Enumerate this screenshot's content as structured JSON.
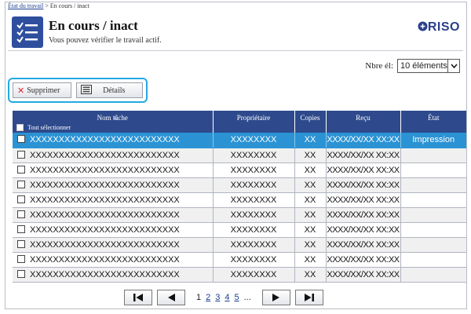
{
  "breadcrumb": {
    "parent": "État du travail",
    "separator": " > ",
    "current": "En cours / inact"
  },
  "header": {
    "title": "En cours / inact",
    "subtitle": "Vous pouvez vérifier le travail actif.",
    "logo_text": "RISO"
  },
  "per_page": {
    "label": "Nbre él:",
    "value": "10 éléments"
  },
  "toolbar": {
    "delete_label": "Supprimer",
    "details_label": "Détails"
  },
  "table": {
    "columns": {
      "name": "Nom tâche",
      "owner": "Propriétaire",
      "copies": "Copies",
      "received": "Reçu",
      "state": "État"
    },
    "select_all_label": "Tout sélectionner",
    "rows": [
      {
        "name": "XXXXXXXXXXXXXXXXXXXXXXXXXX",
        "owner": "XXXXXXXX",
        "copies": "XX",
        "received": "XXXX/XX/XX XX:XX",
        "state": "Impression",
        "active": true
      },
      {
        "name": "XXXXXXXXXXXXXXXXXXXXXXXXXX",
        "owner": "XXXXXXXX",
        "copies": "XX",
        "received": "XXXX/XX/XX XX:XX",
        "state": ""
      },
      {
        "name": "XXXXXXXXXXXXXXXXXXXXXXXXXX",
        "owner": "XXXXXXXX",
        "copies": "XX",
        "received": "XXXX/XX/XX XX:XX",
        "state": ""
      },
      {
        "name": "XXXXXXXXXXXXXXXXXXXXXXXXXX",
        "owner": "XXXXXXXX",
        "copies": "XX",
        "received": "XXXX/XX/XX XX:XX",
        "state": ""
      },
      {
        "name": "XXXXXXXXXXXXXXXXXXXXXXXXXX",
        "owner": "XXXXXXXX",
        "copies": "XX",
        "received": "XXXX/XX/XX XX:XX",
        "state": ""
      },
      {
        "name": "XXXXXXXXXXXXXXXXXXXXXXXXXX",
        "owner": "XXXXXXXX",
        "copies": "XX",
        "received": "XXXX/XX/XX XX:XX",
        "state": ""
      },
      {
        "name": "XXXXXXXXXXXXXXXXXXXXXXXXXX",
        "owner": "XXXXXXXX",
        "copies": "XX",
        "received": "XXXX/XX/XX XX:XX",
        "state": ""
      },
      {
        "name": "XXXXXXXXXXXXXXXXXXXXXXXXXX",
        "owner": "XXXXXXXX",
        "copies": "XX",
        "received": "XXXX/XX/XX XX:XX",
        "state": ""
      },
      {
        "name": "XXXXXXXXXXXXXXXXXXXXXXXXXX",
        "owner": "XXXXXXXX",
        "copies": "XX",
        "received": "XXXX/XX/XX XX:XX",
        "state": ""
      },
      {
        "name": "XXXXXXXXXXXXXXXXXXXXXXXXXX",
        "owner": "XXXXXXXX",
        "copies": "XX",
        "received": "XXXX/XX/XX XX:XX",
        "state": ""
      }
    ]
  },
  "pager": {
    "pages": [
      "1",
      "2",
      "3",
      "4",
      "5"
    ],
    "current": "1",
    "ellipsis": "..."
  },
  "icons": {
    "header": "job-list-icon",
    "logo": "riso-logo-icon",
    "select_arrow": "chevron-down-icon",
    "delete": "x-icon",
    "details": "details-list-icon",
    "first": "first-page-icon",
    "prev": "previous-page-icon",
    "next": "next-page-icon",
    "last": "last-page-icon"
  },
  "colors": {
    "header_blue": "#2e4a8c",
    "active_row": "#2b93d4",
    "toolbar_highlight": "#24a9e1",
    "delete_red": "#d8282e"
  }
}
